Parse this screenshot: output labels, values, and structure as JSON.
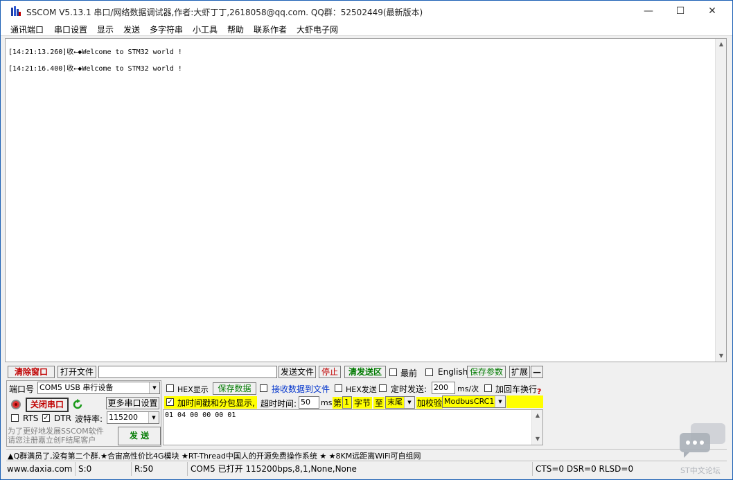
{
  "window": {
    "title": "SSCOM V5.13.1 串口/网络数据调试器,作者:大虾丁丁,2618058@qq.com. QQ群：52502449(最新版本)",
    "minimize": "—",
    "maximize": "☐",
    "close": "✕"
  },
  "menu": [
    "通讯端口",
    "串口设置",
    "显示",
    "发送",
    "多字符串",
    "小工具",
    "帮助",
    "联系作者",
    "大虾电子网"
  ],
  "receive": {
    "lines": [
      "[14:21:13.260]收←◆Welcome to STM32 world !",
      "[14:21:16.400]收←◆Welcome to STM32 world !"
    ]
  },
  "toolbar": {
    "clear_window": "清除窗口",
    "open_file": "打开文件",
    "file_path": "",
    "send_file": "发送文件",
    "stop": "停止",
    "clear_send": "清发送区",
    "topmost": "最前",
    "english": "English",
    "save_params": "保存参数",
    "expand": "扩展",
    "collapse": "—"
  },
  "port": {
    "port_label": "端口号",
    "port_value": "COM5 USB 串行设备",
    "close_port": "关闭串口",
    "more_settings": "更多串口设置",
    "rts": "RTS",
    "dtr": "DTR",
    "baud_label": "波特率:",
    "baud_value": "115200"
  },
  "options": {
    "hex_display": "HEX显示",
    "save_data": "保存数据",
    "recv_to_file": "接收数据到文件",
    "hex_send": "HEX发送",
    "timed_send": "定时发送:",
    "interval": "200",
    "interval_unit": "ms/次",
    "add_crlf": "加回车换行",
    "timestamp": "加时间戳和分包显示,",
    "timeout_label": "超时时间:",
    "timeout_value": "50",
    "timeout_unit": "ms",
    "nth": "第",
    "byte_index": "1",
    "byte_unit": "字节",
    "to": "至",
    "end_value": "末尾",
    "checksum_label": "加校验",
    "checksum_value": "ModbusCRC16",
    "help_mark": "?"
  },
  "send": {
    "content": "01 04 00 00 00 01",
    "send_button": "发 送"
  },
  "promo_left": "为了更好地发展SSCOM软件\n请您注册嘉立创F结尾客户",
  "promo_bar": "▲Q群满员了,没有第二个群.★合宙高性价比4G模块 ★RT-Thread中国人的开源免费操作系统 ★ ★8KM远距离WiFi可自组网",
  "status": {
    "website": "www.daxia.com",
    "sent": "S:0",
    "received": "R:50",
    "port_info": "COM5 已打开  115200bps,8,1,None,None",
    "lines": "CTS=0 DSR=0 RLSD=0"
  },
  "watermark": "ST中文论坛"
}
